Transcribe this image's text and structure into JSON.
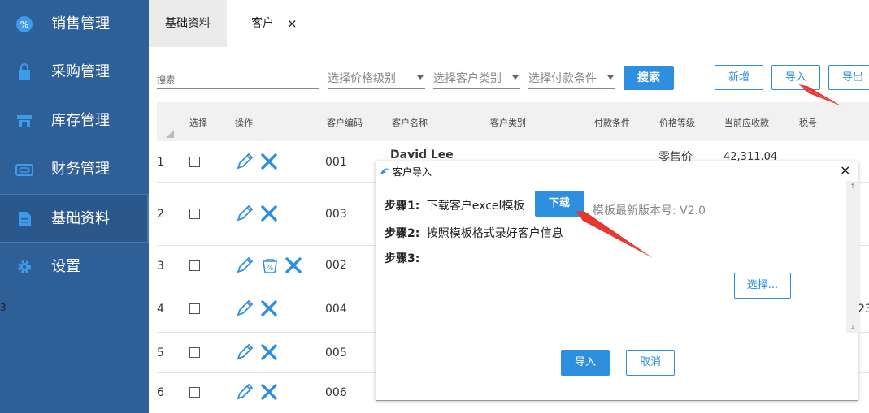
{
  "sidebar": {
    "items": [
      {
        "label": "销售管理",
        "icon": "sales-badge-icon"
      },
      {
        "label": "采购管理",
        "icon": "shopping-bag-icon"
      },
      {
        "label": "库存管理",
        "icon": "warehouse-icon"
      },
      {
        "label": "财务管理",
        "icon": "finance-card-icon"
      },
      {
        "label": "基础资料",
        "icon": "document-icon",
        "active": true
      },
      {
        "label": "设置",
        "icon": "gear-icon"
      }
    ]
  },
  "tabs": [
    {
      "label": "基础资料"
    },
    {
      "label": "客户",
      "close": "×",
      "active": true
    }
  ],
  "filters": {
    "search_placeholder": "搜索",
    "price_level": "选择价格级别",
    "customer_type": "选择客户类别",
    "payment_terms": "选择付款条件",
    "search_button": "搜索",
    "add_button": "新增",
    "import_button": "导入",
    "export_button": "导出"
  },
  "table": {
    "columns": [
      "选择",
      "操作",
      "客户编码",
      "客户名称",
      "客户类别",
      "付款条件",
      "价格等级",
      "当前应收款",
      "税号"
    ],
    "rows": [
      {
        "n": "1",
        "code": "001"
      },
      {
        "n": "2",
        "code": "003"
      },
      {
        "n": "3",
        "code": "002",
        "discount_icon": true
      },
      {
        "n": "4",
        "code": "004"
      },
      {
        "n": "5",
        "code": "005"
      },
      {
        "n": "6",
        "code": "006"
      }
    ],
    "partial": {
      "name_row1": "David Lee",
      "price_level_row1": "零售价",
      "receivable_row1": "42,311.04",
      "edge_right": "23",
      "edge_left": "3"
    }
  },
  "dialog": {
    "title": "客户导入",
    "close": "×",
    "step1_label": "步骤1:",
    "step1_text": "下载客户excel模板",
    "download_button": "下载",
    "version_text": "模板最新版本号: V2.0",
    "step2_label": "步骤2:",
    "step2_text": "按照模板格式录好客户信息",
    "step3_label": "步骤3:",
    "choose_button": "选择...",
    "import_button": "导入",
    "cancel_button": "取消",
    "scroll_up": "↑",
    "scroll_down": "↓"
  },
  "colors": {
    "sidebar": "#2f5f97",
    "primary": "#2e8fde",
    "annotation": "#e8362e"
  }
}
